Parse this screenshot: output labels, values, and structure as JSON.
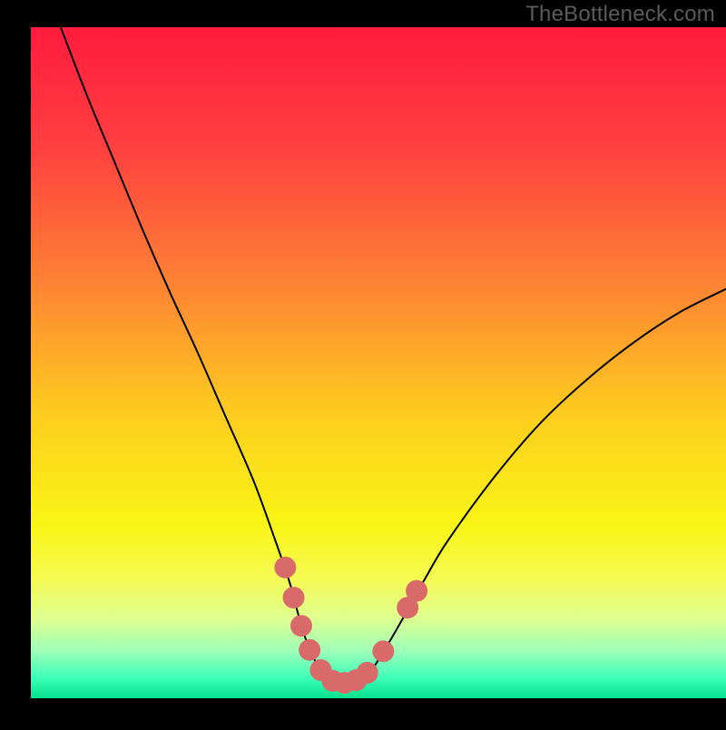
{
  "watermark": "TheBottleneck.com",
  "chart_data": {
    "type": "line",
    "title": "",
    "xlabel": "",
    "ylabel": "",
    "xlim": [
      0,
      100
    ],
    "ylim": [
      0,
      100
    ],
    "grid": false,
    "legend": false,
    "background_gradient": {
      "orientation": "vertical",
      "stops": [
        {
          "offset": 0.0,
          "color": "#ff1b3e"
        },
        {
          "offset": 0.18,
          "color": "#ff4040"
        },
        {
          "offset": 0.38,
          "color": "#fe8234"
        },
        {
          "offset": 0.58,
          "color": "#fdce1f"
        },
        {
          "offset": 0.74,
          "color": "#faf516"
        },
        {
          "offset": 0.82,
          "color": "#f6fb52"
        },
        {
          "offset": 0.88,
          "color": "#e0ff90"
        },
        {
          "offset": 0.93,
          "color": "#9dffb9"
        },
        {
          "offset": 0.97,
          "color": "#3cffb8"
        },
        {
          "offset": 1.0,
          "color": "#05e28d"
        }
      ]
    },
    "series": [
      {
        "name": "bottleneck-curve",
        "color": "#000000",
        "stroke_width": 2,
        "x": [
          4.3,
          8.0,
          12.0,
          16.0,
          20.0,
          24.0,
          28.0,
          32.0,
          35.0,
          37.3,
          38.6,
          40.0,
          41.7,
          43.3,
          45.0,
          46.7,
          48.3,
          50.0,
          53.3,
          56.7,
          60.0,
          66.7,
          73.3,
          80.0,
          86.7,
          93.3,
          100.0
        ],
        "values": [
          100.0,
          90.0,
          80.0,
          70.0,
          60.5,
          51.5,
          42.0,
          32.5,
          24.0,
          17.0,
          12.0,
          7.5,
          4.2,
          2.5,
          2.3,
          2.6,
          3.5,
          5.7,
          11.5,
          17.8,
          23.5,
          33.0,
          41.0,
          47.5,
          53.0,
          57.5,
          61.0
        ]
      }
    ],
    "marker_overlay": {
      "name": "valley-markers",
      "color": "#d96a6a",
      "radius": 12,
      "points": [
        {
          "x": 36.6,
          "y": 19.5
        },
        {
          "x": 37.8,
          "y": 15.0
        },
        {
          "x": 38.9,
          "y": 10.8
        },
        {
          "x": 40.1,
          "y": 7.2
        },
        {
          "x": 41.7,
          "y": 4.2
        },
        {
          "x": 43.4,
          "y": 2.6
        },
        {
          "x": 45.1,
          "y": 2.3
        },
        {
          "x": 46.8,
          "y": 2.7
        },
        {
          "x": 48.4,
          "y": 3.8
        },
        {
          "x": 50.7,
          "y": 7.0
        },
        {
          "x": 54.2,
          "y": 13.5
        },
        {
          "x": 55.5,
          "y": 16.0
        }
      ]
    }
  }
}
